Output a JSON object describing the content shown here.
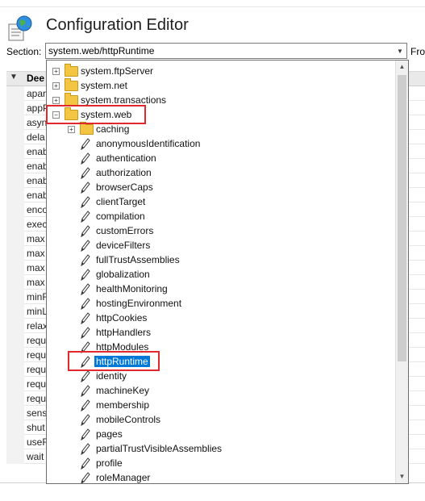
{
  "header": {
    "title": "Configuration Editor",
    "section_label": "Section:",
    "section_value": "system.web/httpRuntime",
    "from_label": "Fro"
  },
  "grid": {
    "header": "Dee",
    "rows": [
      "apar",
      "appP",
      "asyn",
      "dela",
      "enab",
      "enab",
      "enab",
      "enab",
      "enco",
      "exec",
      "max",
      "max",
      "max",
      "max",
      "minF",
      "minL",
      "relax",
      "requ",
      "requ",
      "requ",
      "requ",
      "requ",
      "sens",
      "shut",
      "useF",
      "wait"
    ]
  },
  "tree": {
    "top_nodes": [
      "system.ftpServer",
      "system.net",
      "system.transactions",
      "system.web"
    ],
    "web_children": [
      "caching",
      "anonymousIdentification",
      "authentication",
      "authorization",
      "browserCaps",
      "clientTarget",
      "compilation",
      "customErrors",
      "deviceFilters",
      "fullTrustAssemblies",
      "globalization",
      "healthMonitoring",
      "hostingEnvironment",
      "httpCookies",
      "httpHandlers",
      "httpModules",
      "httpRuntime",
      "identity",
      "machineKey",
      "membership",
      "mobileControls",
      "pages",
      "partialTrustVisibleAssemblies",
      "profile",
      "roleManager"
    ],
    "selected": "httpRuntime"
  },
  "colors": {
    "selection": "#0078d7",
    "highlight_box": "#e0282d",
    "folder": "#f4c542"
  }
}
